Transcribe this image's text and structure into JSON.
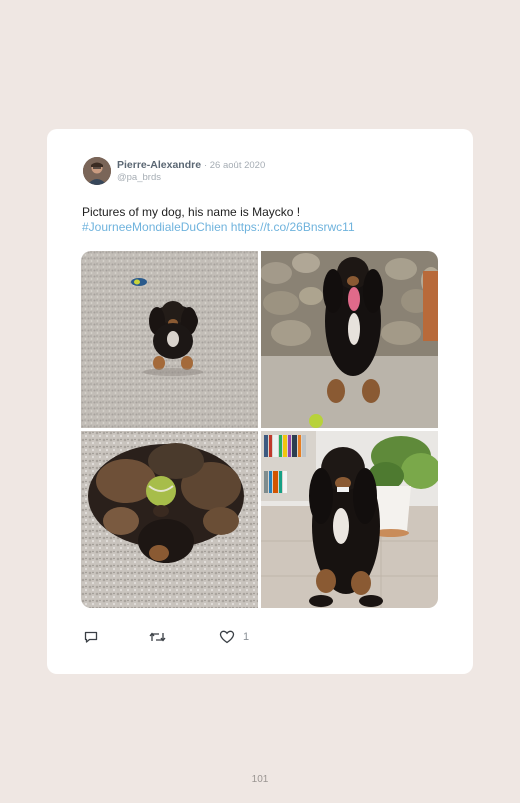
{
  "tweet": {
    "author_name": "Pierre-Alexandre",
    "date": "· 26 août 2020",
    "handle": "@pa_brds",
    "text_line": "Pictures of my dog, his name is Maycko !",
    "hashtag": "#JourneeMondialeDuChien",
    "url": "https://t.co/26Bnsrwc11",
    "like_count": "1",
    "icons": {
      "reply": "reply-icon",
      "retweet": "retweet-icon",
      "like": "heart-icon"
    }
  },
  "photos": [
    {
      "name": "dog-lying-on-gravel-photo"
    },
    {
      "name": "dog-sitting-by-stone-wall-photo"
    },
    {
      "name": "dog-on-back-with-ball-photo"
    },
    {
      "name": "dog-sitting-indoors-photo"
    }
  ],
  "page": {
    "number": "101"
  },
  "colors": {
    "background": "#efe7e3",
    "card": "#ffffff",
    "link": "#6fb3dd",
    "name": "#5b6773",
    "muted": "#a6adb4"
  }
}
